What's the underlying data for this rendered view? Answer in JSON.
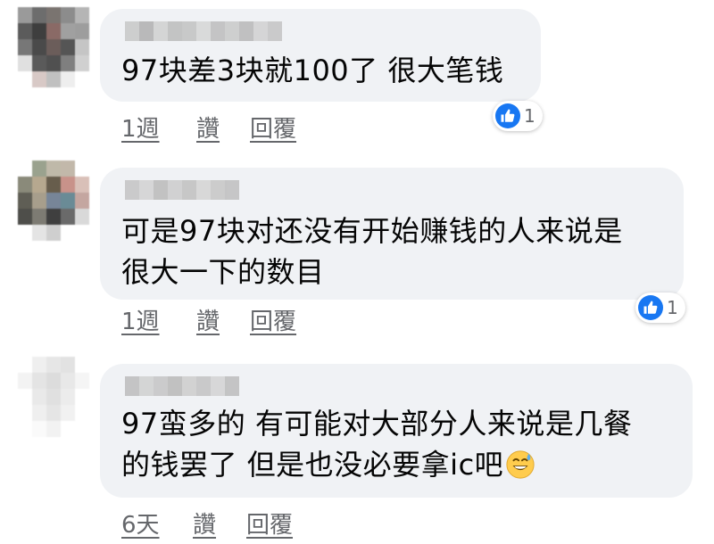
{
  "comments": [
    {
      "text_lines": [
        "97块差3块就100了 很大笔钱"
      ],
      "time": "1週",
      "like_label": "讚",
      "reply_label": "回覆",
      "reaction_count": "1",
      "reaction_icon": "like-icon"
    },
    {
      "text_lines": [
        "可是97块对还没有开始赚钱的人来说是",
        "很大一下的数目"
      ],
      "time": "1週",
      "like_label": "讚",
      "reply_label": "回覆",
      "reaction_count": "1",
      "reaction_icon": "like-icon"
    },
    {
      "text_lines": [
        "97蛮多的 有可能对大部分人来说是几餐",
        "的钱罢了 但是也没必要拿ic吧"
      ],
      "trailing_emoji": "grinning-face-with-sweat-emoji",
      "time": "6天",
      "like_label": "讚",
      "reply_label": "回覆"
    }
  ],
  "colors": {
    "bubble": "#f0f2f5",
    "text": "#050505",
    "meta": "#65676b",
    "like_blue": "#1877f2"
  }
}
